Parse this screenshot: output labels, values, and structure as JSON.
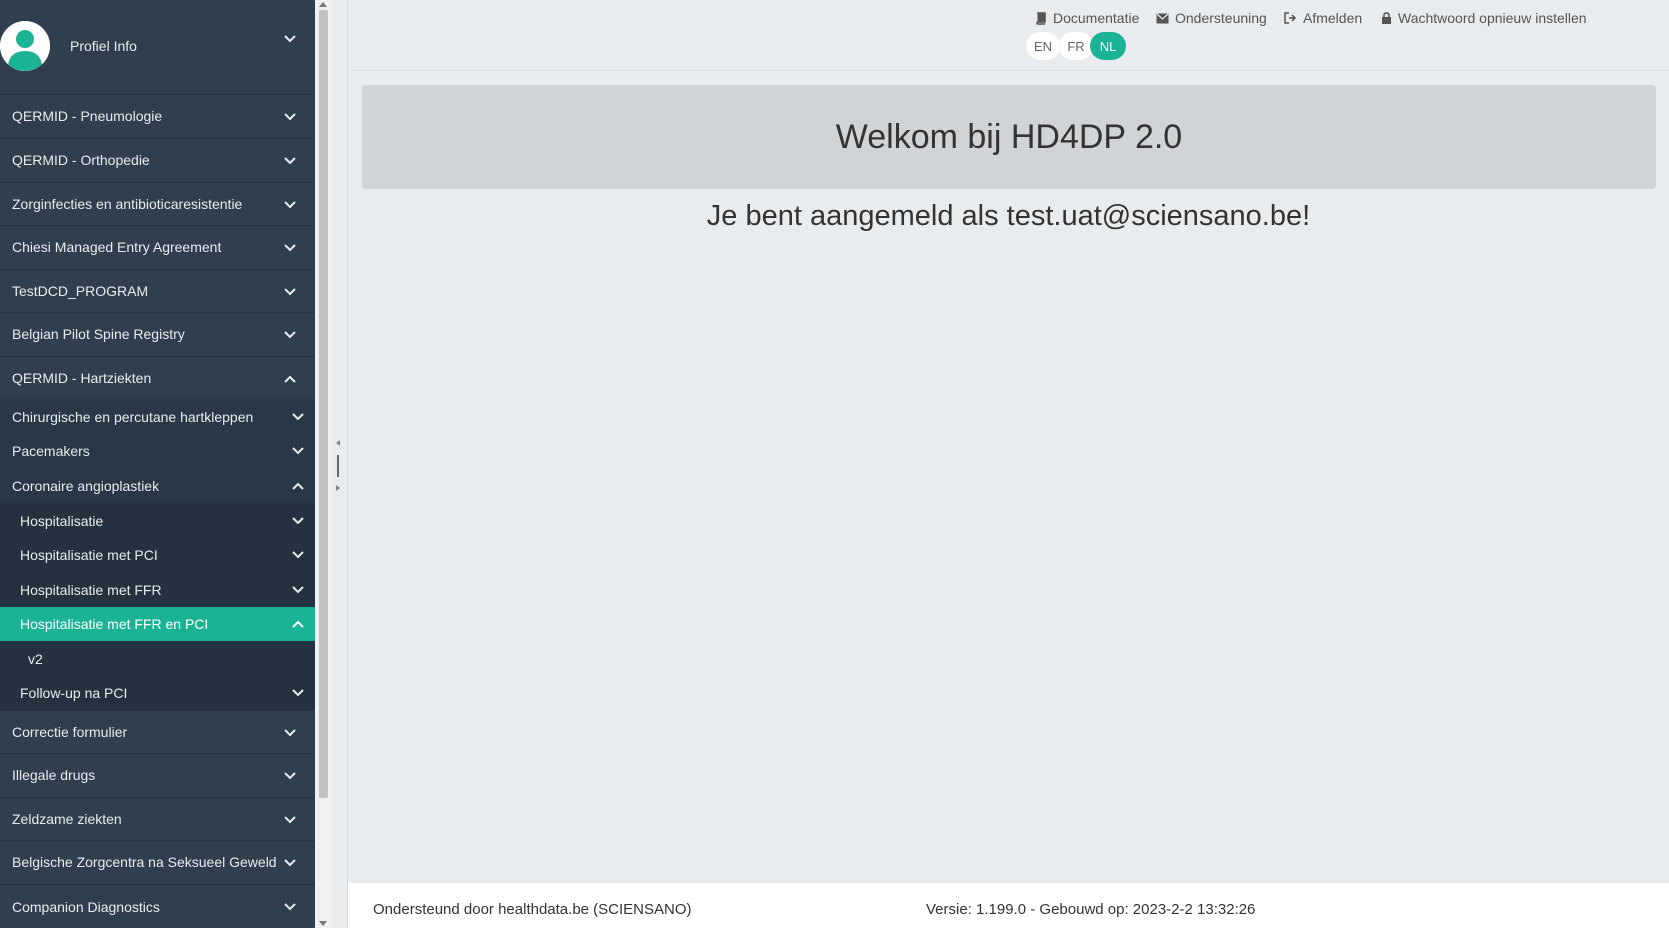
{
  "sidebar": {
    "profile_label": "Profiel Info",
    "items": [
      {
        "label": "QERMID - Pneumologie"
      },
      {
        "label": "QERMID - Orthopedie"
      },
      {
        "label": "Zorginfecties en antibioticaresistentie"
      },
      {
        "label": "Chiesi Managed Entry Agreement"
      },
      {
        "label": "TestDCD_PROGRAM"
      },
      {
        "label": "Belgian Pilot Spine Registry"
      },
      {
        "label": "QERMID - Hartziekten"
      },
      {
        "label": "Chirurgische en percutane hartkleppen"
      },
      {
        "label": "Pacemakers"
      },
      {
        "label": "Coronaire angioplastiek"
      },
      {
        "label": "Hospitalisatie"
      },
      {
        "label": "Hospitalisatie met PCI"
      },
      {
        "label": "Hospitalisatie met FFR"
      },
      {
        "label": "Hospitalisatie met FFR en PCI"
      },
      {
        "label": "v2"
      },
      {
        "label": "Follow-up na PCI"
      },
      {
        "label": "Correctie formulier"
      },
      {
        "label": "Illegale drugs"
      },
      {
        "label": "Zeldzame ziekten"
      },
      {
        "label": "Belgische Zorgcentra na Seksueel Geweld"
      },
      {
        "label": "Companion Diagnostics"
      }
    ]
  },
  "header": {
    "links": {
      "documentation": "Documentatie",
      "support": "Ondersteuning",
      "logout": "Afmelden",
      "reset_password": "Wachtwoord opnieuw instellen"
    },
    "languages": [
      "EN",
      "FR",
      "NL"
    ],
    "active_language": "NL"
  },
  "main": {
    "welcome_title": "Welkom bij HD4DP 2.0",
    "logged_prefix": "Je bent aangemeld als ",
    "logged_email": "test.uat@sciensano.be",
    "logged_suffix": "!"
  },
  "footer": {
    "supported_by": "Ondersteund door healthdata.be (SCIENSANO)",
    "version": "Versie: 1.199.0  -  Gebouwd op: 2023-2-2 13:32:26"
  },
  "colors": {
    "sidebar_bg": "#2f3f4e",
    "accent": "#1ab394"
  }
}
